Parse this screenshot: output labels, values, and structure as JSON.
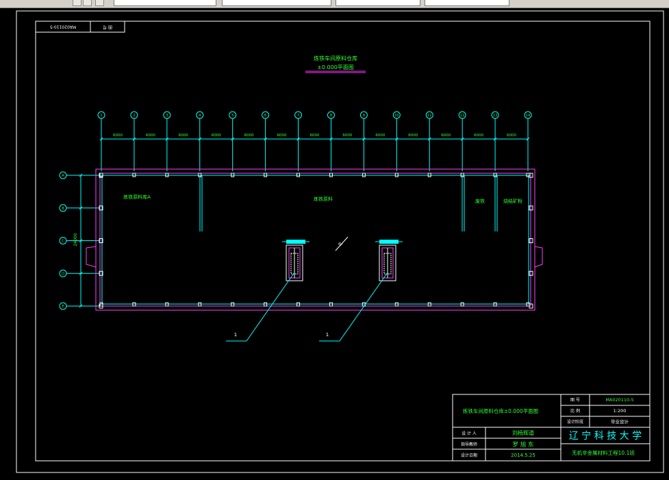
{
  "toolbar": {
    "fields": [
      "",
      "",
      "",
      "",
      ""
    ],
    "note": ""
  },
  "drawing": {
    "corner_code": "MA020110-5",
    "corner_label": "图 号",
    "title_line1": "炼铁车间原料仓库",
    "title_line2": "±0.000平面图",
    "column_labels": [
      "1",
      "2",
      "3",
      "4",
      "5",
      "6",
      "7",
      "8",
      "9",
      "10",
      "11",
      "12",
      "13",
      "14"
    ],
    "bay_dimension": "6000",
    "row_labels": [
      "A",
      "B",
      "C",
      "D",
      "E"
    ],
    "total_height_dim": "24000",
    "room_labels": {
      "left": "炼铁原料库A",
      "center": "炼铁原料",
      "right1": "废铁",
      "right2": "烧结矿粉"
    },
    "north_label": "北",
    "leader_labels": [
      "1",
      "1"
    ]
  },
  "title_block": {
    "drawing_name": "炼铁车间原料仓库±0.000平面图",
    "rows": [
      {
        "label": "图 号",
        "value": "MA020110-5"
      },
      {
        "label": "比 例",
        "value": "1:200"
      },
      {
        "label": "设计阶段",
        "value": "毕业设计"
      }
    ],
    "designer_label": "设 计 人",
    "designer": "刘杨辉道",
    "advisor_label": "指导教师",
    "advisor": "罗 旭 东",
    "date_label": "设计日期",
    "date": "2014.5.25",
    "university": "辽 宁 科 技 大 学",
    "class_name": "无机非金属材料工程10.1班"
  },
  "colors": {
    "background": "#000000",
    "frame": "#ffffff",
    "text_green": "#33ff33",
    "dimension_cyan": "#00ffff",
    "wall_magenta": "#ff44ff",
    "title_underline": "#ff33ff"
  }
}
